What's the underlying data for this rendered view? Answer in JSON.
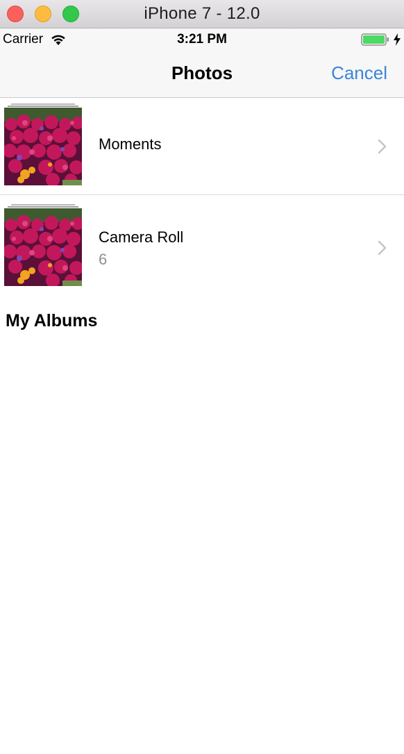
{
  "window": {
    "title": "iPhone 7 - 12.0"
  },
  "status_bar": {
    "carrier": "Carrier",
    "time": "3:21 PM"
  },
  "nav": {
    "title": "Photos",
    "cancel_label": "Cancel"
  },
  "albums": [
    {
      "name": "Moments",
      "count": ""
    },
    {
      "name": "Camera Roll",
      "count": "6"
    }
  ],
  "section": {
    "my_albums": "My Albums"
  },
  "colors": {
    "accent": "#3a85d8",
    "battery": "#4cd964",
    "thumbnail_flowers": "#c2185b"
  }
}
